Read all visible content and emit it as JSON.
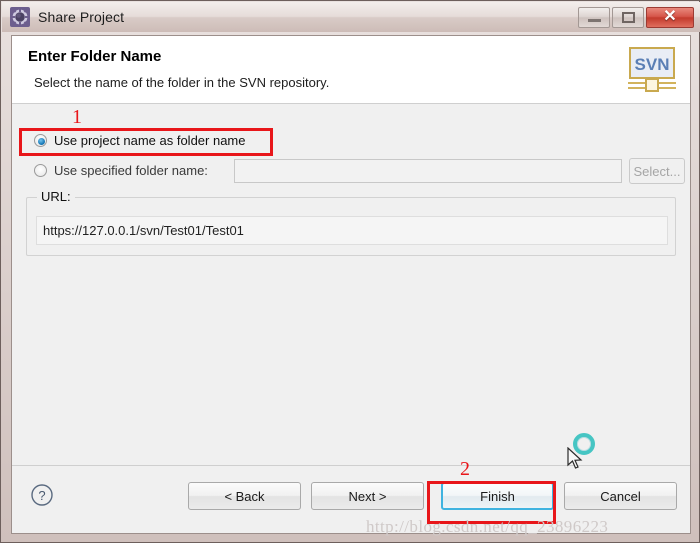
{
  "window": {
    "title": "Share Project",
    "icon": "gear-icon",
    "frame_color": "#6d5f5c",
    "titlebar_gradient_top": "#f3eeec",
    "titlebar_gradient_bottom": "#cdbcb7",
    "buttons": {
      "minimize_label": "–",
      "maximize_label": "□",
      "close_label": "✕",
      "close_color": "#c33a2c"
    }
  },
  "header": {
    "title": "Enter Folder Name",
    "description": "Select the name of the folder in the SVN repository.",
    "logo_text": "SVN",
    "logo_color": "#5b7fb5"
  },
  "body": {
    "options": [
      {
        "label": "Use project name as folder name",
        "checked": true,
        "enabled": true
      },
      {
        "label": "Use specified folder name:",
        "checked": false,
        "enabled": false
      }
    ],
    "folder_input": {
      "value": "",
      "placeholder": ""
    },
    "select_button": {
      "label": "Select...",
      "enabled": false
    },
    "url_group": {
      "legend": "URL:",
      "value": "https://127.0.0.1/svn/Test01/Test01"
    }
  },
  "footer": {
    "help_label": "?",
    "buttons": [
      {
        "label": "< Back",
        "default": false
      },
      {
        "label": "Next >",
        "default": false
      },
      {
        "label": "Finish",
        "default": true
      },
      {
        "label": "Cancel",
        "default": false
      }
    ]
  },
  "annotations": {
    "color": "#e8161a",
    "step_one": "1",
    "step_two": "2"
  },
  "watermark": {
    "text": "http://blog.csdn.net/qq_23896223"
  }
}
